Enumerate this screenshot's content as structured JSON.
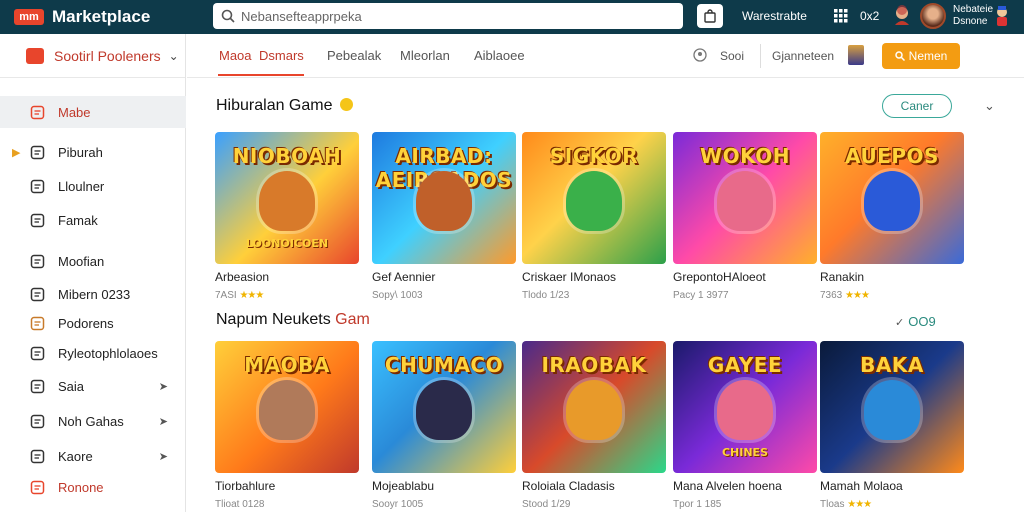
{
  "app": {
    "logo_mark": "mm",
    "title": "Marketplace"
  },
  "search": {
    "placeholder": "Nebansefteapprpeka"
  },
  "topbar": {
    "label": "Warestrabte",
    "count": "0x2",
    "user_line1": "Nebateie",
    "user_line2": "Dsnone"
  },
  "sidebar": {
    "header": "Sootirl Pooleners",
    "items": [
      {
        "label": "Mabe",
        "icon": "store-icon"
      },
      {
        "label": "Piburah",
        "icon": "book-icon"
      },
      {
        "label": "Lloulner",
        "icon": "controller-icon"
      },
      {
        "label": "Famak",
        "icon": "document-icon"
      },
      {
        "label": "Moofian",
        "icon": "gamepad-icon"
      },
      {
        "label": "Mibern 0233",
        "icon": "list-icon"
      },
      {
        "label": "Podorens",
        "icon": "box-icon"
      },
      {
        "label": "Ryleotophlolaoes",
        "icon": "table-icon"
      },
      {
        "label": "Saia",
        "icon": "tag-icon"
      },
      {
        "label": "Noh Gahas",
        "icon": "home-icon"
      },
      {
        "label": "Kaore",
        "icon": "headset-icon"
      },
      {
        "label": "Ronone",
        "icon": "heart-icon"
      }
    ]
  },
  "tabs": {
    "t1": "Maoa",
    "t2": "Dsmars",
    "t3": "Pebealak",
    "t4": "Mleorlan",
    "t5": "Aiblaoee"
  },
  "toolbar": {
    "sort": "Sooi",
    "genre": "Gjanneteen",
    "cta": "Nemen"
  },
  "section1": {
    "title": "Hiburalan Game",
    "pill": "Caner"
  },
  "section2": {
    "title_a": "Napum Neukets",
    "title_b": "Gam",
    "right": "OO9"
  },
  "row1": [
    {
      "title": "NIOBOAH",
      "subtitle": "LOONOICOEN",
      "name": "Arbeasion",
      "meta": "7ASI",
      "stars": "★★★"
    },
    {
      "title": "AIRBAD: AEIROADOS",
      "subtitle": "",
      "name": "Gef Aennier",
      "meta": "Sopy\\ 1003",
      "stars": ""
    },
    {
      "title": "SIGKOR",
      "subtitle": "",
      "name": "Criskaer IMonaos",
      "meta": "Tlodo 1/23",
      "stars": ""
    },
    {
      "title": "WOKOH",
      "subtitle": "",
      "name": "GrepontoHAloeot",
      "meta": "Pacy 1 3977",
      "stars": ""
    },
    {
      "title": "AUEPOS",
      "subtitle": "",
      "name": "Ranakin",
      "meta": "7363",
      "stars": "★★★"
    }
  ],
  "row2": [
    {
      "title": "MAOBA",
      "subtitle": "",
      "name": "Tiorbahlure",
      "meta": "Tlioat 0128",
      "stars": ""
    },
    {
      "title": "CHUMACO",
      "subtitle": "",
      "name": "Mojeablabu",
      "meta": "Sooyr 1005",
      "stars": ""
    },
    {
      "title": "IRAOBAK",
      "subtitle": "",
      "name": "Roloiala Cladasis",
      "meta": "Stood 1/29",
      "stars": ""
    },
    {
      "title": "GAYEE",
      "subtitle": "CHINES",
      "name": "Mana Alvelen hoena",
      "meta": "Tpor 1 185",
      "stars": ""
    },
    {
      "title": "BAKA",
      "subtitle": "",
      "name": "Mamah Molaoa",
      "meta": "Tloas",
      "stars": "★★★"
    }
  ],
  "colors": {
    "topbar": "#0e3a4a",
    "accent": "#e8452c",
    "cta": "#f39c12",
    "teal": "#2a8a7e"
  }
}
